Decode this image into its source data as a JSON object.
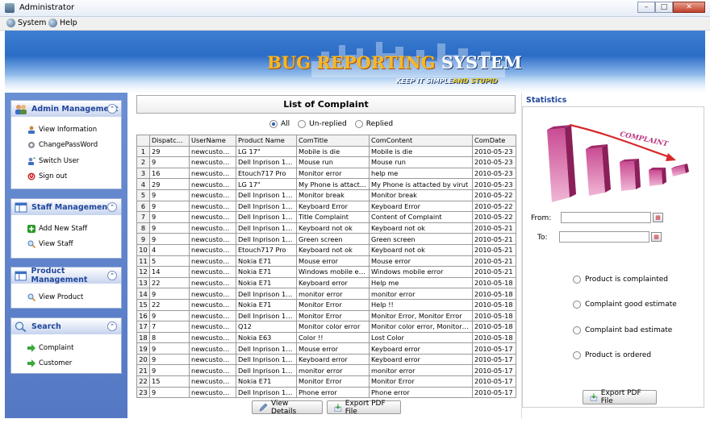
{
  "window": {
    "title": "Administrator"
  },
  "menu": [
    {
      "label": "System",
      "icon": "system-icon"
    },
    {
      "label": "Help",
      "icon": "help-icon"
    }
  ],
  "banner": {
    "title_part1": "BUG REPORTING",
    "title_part2": " SYSTEM",
    "slogan_part1": "KEEP IT SIMPLE",
    "slogan_part2": "AND STUPID"
  },
  "sidebar": {
    "admin": {
      "title": "Admin Management",
      "items": [
        "View Information",
        "ChangePassWord",
        "Switch User",
        "Sign out"
      ]
    },
    "staff": {
      "title": "Staff Management",
      "items": [
        "Add New Staff",
        "View Staff"
      ]
    },
    "product": {
      "title": "Product Management",
      "items": [
        "View Product"
      ]
    },
    "search": {
      "title": "Search",
      "items": [
        "Complaint",
        "Customer"
      ]
    }
  },
  "complaints": {
    "heading": "List of Complaint",
    "filters": [
      {
        "label": "All",
        "selected": true
      },
      {
        "label": "Un-replied",
        "selected": false
      },
      {
        "label": "Replied",
        "selected": false
      }
    ],
    "columns": [
      "DispatchNo",
      "UserName",
      "Product Name",
      "ComTitle",
      "ComContent",
      "ComDate"
    ],
    "rows": [
      [
        "1",
        "29",
        "newcustomer",
        "LG 17\"",
        "Mobile is die",
        "Mobile is die",
        "2010-05-23"
      ],
      [
        "2",
        "9",
        "newcustomer",
        "Dell Inprison 1545",
        "Mouse run",
        "Mouse run",
        "2010-05-23"
      ],
      [
        "3",
        "16",
        "newcustomer",
        "Etouch717 Pro",
        "Monitor error",
        "help me",
        "2010-05-23"
      ],
      [
        "4",
        "29",
        "newcustomer",
        "LG 17\"",
        "My Phone is attacted ...",
        "My Phone is attacted by virut",
        "2010-05-23"
      ],
      [
        "5",
        "9",
        "newcustomer",
        "Dell Inprison 1545",
        "Monitor break",
        "Monitor break",
        "2010-05-22"
      ],
      [
        "6",
        "9",
        "newcustomer",
        "Dell Inprison 1545",
        "Keyboard Error",
        "Keyboard Error",
        "2010-05-22"
      ],
      [
        "7",
        "9",
        "newcustomer",
        "Dell Inprison 1545",
        "Title Complaint",
        "Content of Complaint",
        "2010-05-22"
      ],
      [
        "8",
        "9",
        "newcustomer",
        "Dell Inprison 1545",
        "Keyboard not ok",
        "Keyboard not ok",
        "2010-05-21"
      ],
      [
        "9",
        "9",
        "newcustomer",
        "Dell Inprison 1545",
        "Green screen",
        "Green screen",
        "2010-05-21"
      ],
      [
        "10",
        "4",
        "newcustomer",
        "Etouch717 Pro",
        "Keyboard not ok",
        "Keyboard not ok",
        "2010-05-21"
      ],
      [
        "11",
        "5",
        "newcustomer",
        "Nokia E71",
        "Mouse error",
        "Mouse error",
        "2010-05-21"
      ],
      [
        "12",
        "14",
        "newcustomer",
        "Nokia E71",
        "Windows mobile error",
        "Windows mobile error",
        "2010-05-21"
      ],
      [
        "13",
        "22",
        "newcustomer",
        "Nokia E71",
        "Keyboard error",
        "Help me",
        "2010-05-18"
      ],
      [
        "14",
        "9",
        "newcustomer",
        "Dell Inprison 1545",
        "monitor error",
        "monitor error",
        "2010-05-18"
      ],
      [
        "15",
        "22",
        "newcustomer",
        "Nokia E71",
        "Monitor Error",
        "Help !!",
        "2010-05-18"
      ],
      [
        "16",
        "9",
        "newcustomer",
        "Dell Inprison 1545",
        "Monitor Error",
        "Monitor Error, Monitor Error",
        "2010-05-18"
      ],
      [
        "17",
        "7",
        "newcustomer",
        "Q12",
        "Monitor color error",
        "Monitor color error, Monitor colo...",
        "2010-05-18"
      ],
      [
        "18",
        "8",
        "newcustomer",
        "Nokia E63",
        "Color !!",
        "Lost Color",
        "2010-05-18"
      ],
      [
        "19",
        "9",
        "newcustomer",
        "Dell Inprison 1545",
        "Mouse error",
        "Keyboard error",
        "2010-05-17"
      ],
      [
        "20",
        "9",
        "newcustomer",
        "Dell Inprison 1545",
        "Keyboard error",
        "Keyboard error",
        "2010-05-17"
      ],
      [
        "21",
        "9",
        "newcustomer",
        "Dell Inprison 1545",
        "monitor error",
        "monitor error",
        "2010-05-17"
      ],
      [
        "22",
        "15",
        "newcustomer",
        "Nokia E71",
        "Monitor Error",
        "Monitor Error",
        "2010-05-17"
      ],
      [
        "23",
        "9",
        "newcustomer",
        "Dell Inprison 1545",
        "Phone error",
        "Phone error",
        "2010-05-17"
      ]
    ],
    "buttons": {
      "details": "View Details",
      "export": "Export PDF File"
    }
  },
  "statistics": {
    "title": "Statistics",
    "chart_label": "COMPLAINT",
    "chart_colors": {
      "bar": "#b8347e",
      "bar_light": "#e89fc7",
      "arrow": "#d8282a"
    },
    "from_label": "From:",
    "to_label": "To:",
    "from_value": "",
    "to_value": "",
    "options": [
      "Product is complainted",
      "Complaint good estimate",
      "Complaint bad estimate",
      "Product is ordered"
    ],
    "export_label": "Export PDF File"
  }
}
